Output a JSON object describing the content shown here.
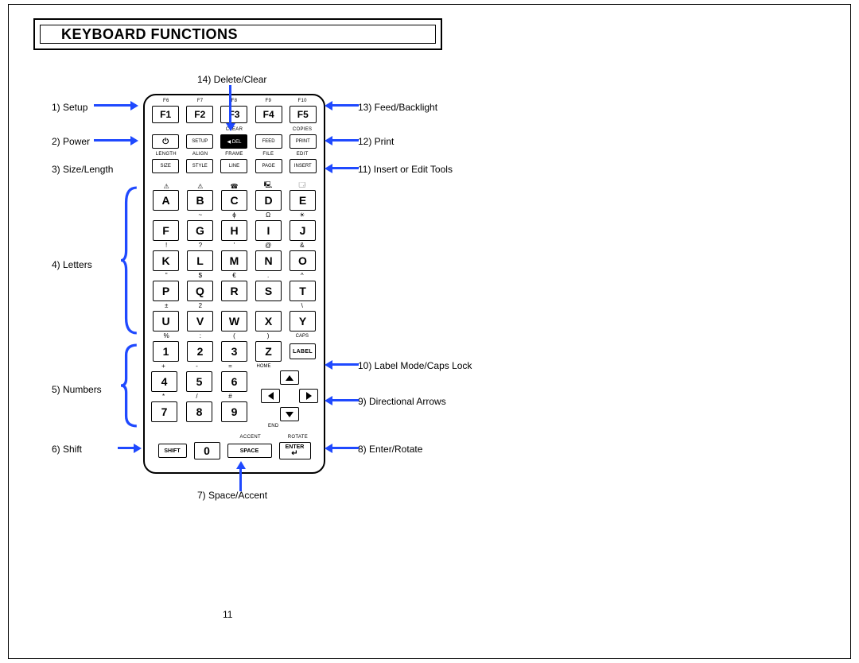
{
  "heading": "KEYBOARD FUNCTIONS",
  "page_number": "11",
  "fn_top": [
    "F6",
    "F7",
    "F8",
    "F9",
    "F10"
  ],
  "fn_keys": [
    "F1",
    "F2",
    "F3",
    "F4",
    "F5"
  ],
  "fn2_top": [
    "",
    "",
    "CLEAR",
    "",
    "COPIES"
  ],
  "fn2_keys": [
    "⏻",
    "SETUP",
    "◀ DEL",
    "FEED",
    "PRINT"
  ],
  "fn3_top": [
    "LENGTH",
    "ALIGN",
    "FRAME",
    "FILE",
    "EDIT"
  ],
  "fn3_keys": [
    "SIZE",
    "STYLE",
    "LINE",
    "PAGE",
    "INSERT"
  ],
  "row1_sym": [
    "⚠",
    "⚠",
    "☎",
    "🖳",
    "🗔"
  ],
  "row1": [
    "A",
    "B",
    "C",
    "D",
    "E"
  ],
  "row2_sym": [
    "",
    "~",
    "ɸ",
    "Ω",
    "☀"
  ],
  "row2": [
    "F",
    "G",
    "H",
    "I",
    "J"
  ],
  "row3_sym": [
    "!",
    "?",
    "'",
    "@",
    "&"
  ],
  "row3": [
    "K",
    "L",
    "M",
    "N",
    "O"
  ],
  "row4_sym": [
    "\"",
    "$",
    "€",
    ".",
    "^"
  ],
  "row4": [
    "P",
    "Q",
    "R",
    "S",
    "T"
  ],
  "row5_sym": [
    "±",
    "2",
    "",
    "",
    "\\"
  ],
  "row5": [
    "U",
    "V",
    "W",
    "X",
    "Y"
  ],
  "row6_sym": [
    "%",
    ":",
    "(",
    ")",
    "CAPS"
  ],
  "row6": [
    "1",
    "2",
    "3",
    "Z",
    "LABEL"
  ],
  "row7_sym": [
    "+",
    "-",
    "=",
    "HOME",
    ""
  ],
  "row7": [
    "4",
    "5",
    "6"
  ],
  "row8_sym": [
    "*",
    "/",
    "#",
    "",
    ""
  ],
  "row8": [
    "7",
    "8",
    "9"
  ],
  "bottom_top": [
    "",
    "",
    "ACCENT",
    "ROTATE"
  ],
  "bottom": {
    "shift": "SHIFT",
    "zero": "0",
    "space": "SPACE",
    "enter": "ENTER",
    "enter_arrow": "↵",
    "end": "END"
  },
  "callouts": {
    "c1": "1) Setup",
    "c2": "2) Power",
    "c3": "3) Size/Length",
    "c4": "4) Letters",
    "c5": "5) Numbers",
    "c6": "6) Shift",
    "c7": "7) Space/Accent",
    "c8": "8) Enter/Rotate",
    "c9": "9) Directional Arrows",
    "c10": "10) Label Mode/Caps Lock",
    "c11": "11) Insert or Edit Tools",
    "c12": "12) Print",
    "c13": "13) Feed/Backlight",
    "c14": "14) Delete/Clear"
  }
}
